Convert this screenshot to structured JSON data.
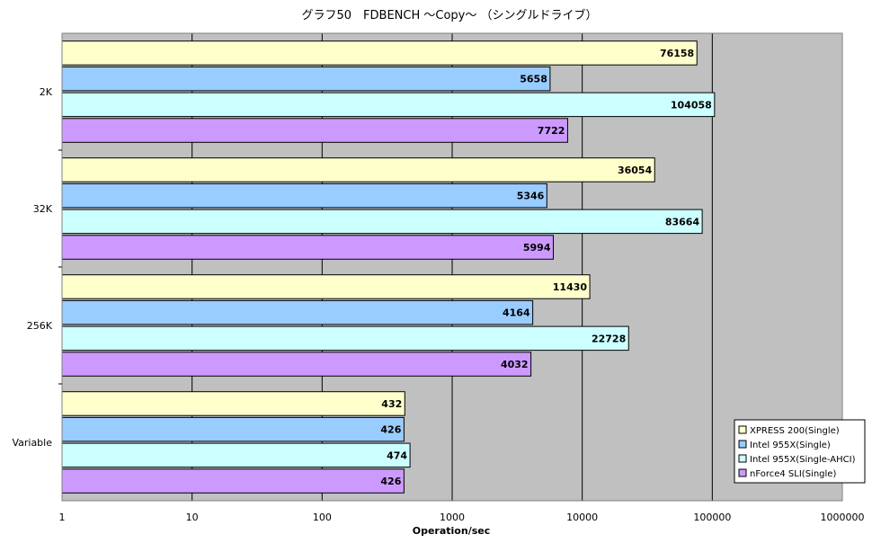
{
  "chart_data": {
    "type": "bar",
    "orientation": "horizontal",
    "title": "グラフ50　FDBENCH ～Copy～ （シングルドライブ）",
    "xlabel": "Operation/sec",
    "ylabel": "",
    "x_scale": "log",
    "xlim": [
      1,
      1000000
    ],
    "x_ticks": [
      "1",
      "10",
      "100",
      "1000",
      "10000",
      "100000",
      "1000000"
    ],
    "grid": true,
    "legend_position": "bottom-right",
    "categories": [
      "2K",
      "32K",
      "256K",
      "Variable"
    ],
    "series": [
      {
        "name": "XPRESS 200(Single)",
        "color": "#ffffcc",
        "values": [
          76158,
          36054,
          11430,
          432
        ]
      },
      {
        "name": "Intel 955X(Single)",
        "color": "#99ccff",
        "values": [
          5658,
          5346,
          4164,
          426
        ]
      },
      {
        "name": "Intel 955X(Single-AHCI)",
        "color": "#ccffff",
        "values": [
          104058,
          83664,
          22728,
          474
        ]
      },
      {
        "name": "nForce4 SLI(Single)",
        "color": "#cc99ff",
        "values": [
          7722,
          5994,
          4032,
          426
        ]
      }
    ],
    "plot_background": "#c0c0c0"
  }
}
